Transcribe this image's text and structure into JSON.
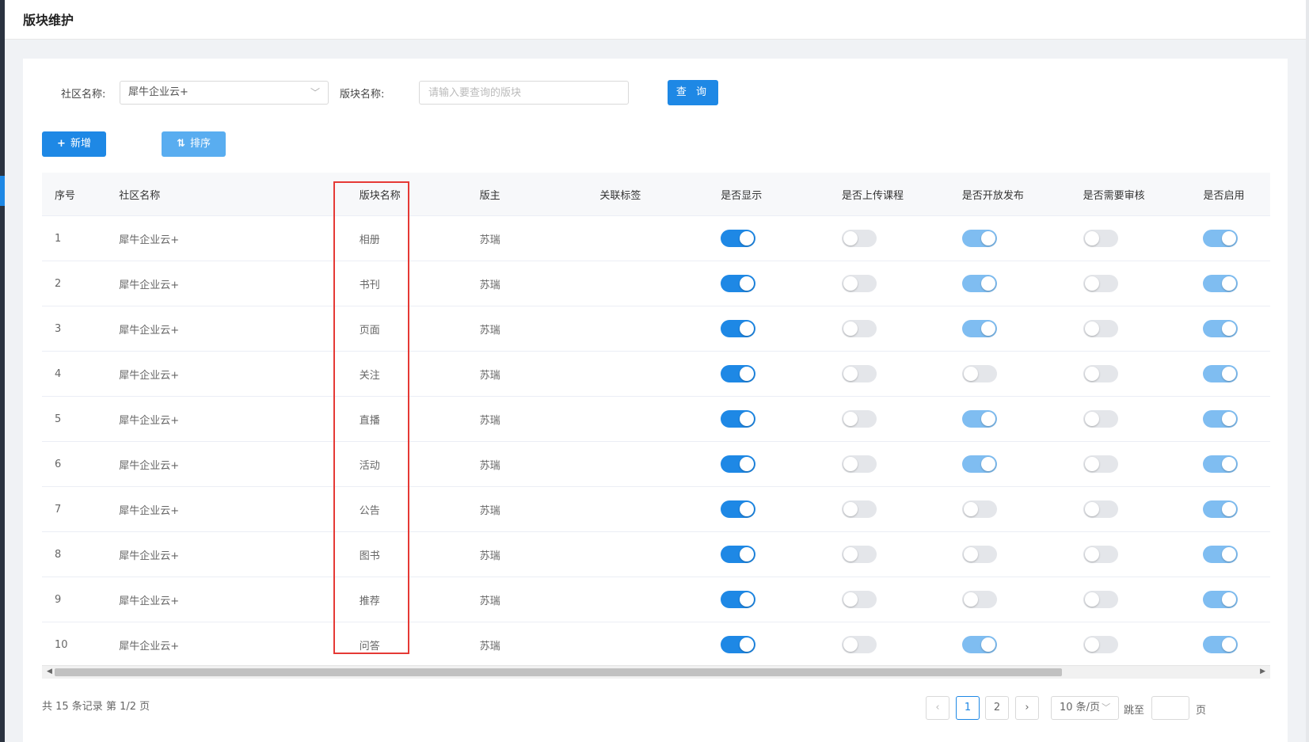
{
  "page": {
    "title": "版块维护"
  },
  "filters": {
    "community_label": "社区名称:",
    "community_value": "犀牛企业云+",
    "block_label": "版块名称:",
    "block_placeholder": "请输入要查询的版块",
    "query_button": "查 询"
  },
  "actions": {
    "add_label": "新增",
    "sort_label": "排序"
  },
  "table": {
    "headers": [
      "序号",
      "社区名称",
      "版块名称",
      "版主",
      "关联标签",
      "是否显示",
      "是否上传课程",
      "是否开放发布",
      "是否需要审核",
      "是否启用"
    ],
    "rows": [
      {
        "index": "1",
        "community": "犀牛企业云+",
        "block": "相册",
        "moderator": "苏瑞",
        "tag": "",
        "show": "on",
        "upload": "off",
        "publish": "on",
        "review": "off",
        "enable": "on"
      },
      {
        "index": "2",
        "community": "犀牛企业云+",
        "block": "书刊",
        "moderator": "苏瑞",
        "tag": "",
        "show": "on",
        "upload": "off",
        "publish": "on",
        "review": "off",
        "enable": "on"
      },
      {
        "index": "3",
        "community": "犀牛企业云+",
        "block": "页面",
        "moderator": "苏瑞",
        "tag": "",
        "show": "on",
        "upload": "off",
        "publish": "on",
        "review": "off",
        "enable": "on"
      },
      {
        "index": "4",
        "community": "犀牛企业云+",
        "block": "关注",
        "moderator": "苏瑞",
        "tag": "",
        "show": "on",
        "upload": "off",
        "publish": "off",
        "review": "off",
        "enable": "on"
      },
      {
        "index": "5",
        "community": "犀牛企业云+",
        "block": "直播",
        "moderator": "苏瑞",
        "tag": "",
        "show": "on",
        "upload": "off",
        "publish": "on",
        "review": "off",
        "enable": "on"
      },
      {
        "index": "6",
        "community": "犀牛企业云+",
        "block": "活动",
        "moderator": "苏瑞",
        "tag": "",
        "show": "on",
        "upload": "off",
        "publish": "on",
        "review": "off",
        "enable": "on"
      },
      {
        "index": "7",
        "community": "犀牛企业云+",
        "block": "公告",
        "moderator": "苏瑞",
        "tag": "",
        "show": "on",
        "upload": "off",
        "publish": "off",
        "review": "off",
        "enable": "on"
      },
      {
        "index": "8",
        "community": "犀牛企业云+",
        "block": "图书",
        "moderator": "苏瑞",
        "tag": "",
        "show": "on",
        "upload": "off",
        "publish": "off",
        "review": "off",
        "enable": "on"
      },
      {
        "index": "9",
        "community": "犀牛企业云+",
        "block": "推荐",
        "moderator": "苏瑞",
        "tag": "",
        "show": "on",
        "upload": "off",
        "publish": "off",
        "review": "off",
        "enable": "on"
      },
      {
        "index": "10",
        "community": "犀牛企业云+",
        "block": "问答",
        "moderator": "苏瑞",
        "tag": "",
        "show": "on",
        "upload": "off",
        "publish": "on",
        "review": "off",
        "enable": "on"
      }
    ]
  },
  "pagination": {
    "total_text": "共 15 条记录 第 1/2 页",
    "pages": [
      "1",
      "2"
    ],
    "current_page": "1",
    "page_size": "10 条/页",
    "jump_label": "跳至",
    "page_suffix": "页"
  },
  "colors": {
    "primary": "#1e88e5",
    "light": "#7fbdf1",
    "off": "#e4e6ea",
    "highlight": "#e53935"
  }
}
